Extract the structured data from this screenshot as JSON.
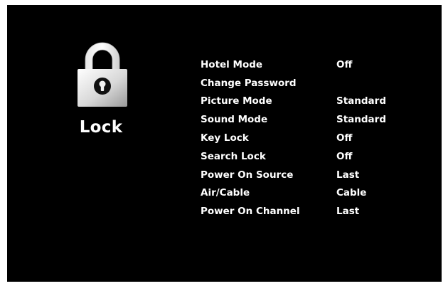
{
  "section": {
    "title": "Lock",
    "icon": "padlock-icon"
  },
  "menu": {
    "items": [
      {
        "label": "Hotel Mode",
        "value": "Off"
      },
      {
        "label": "Change Password",
        "value": ""
      },
      {
        "label": "Picture Mode",
        "value": "Standard"
      },
      {
        "label": "Sound Mode",
        "value": "Standard"
      },
      {
        "label": "Key Lock",
        "value": "Off"
      },
      {
        "label": "Search Lock",
        "value": "Off"
      },
      {
        "label": "Power On Source",
        "value": "Last"
      },
      {
        "label": "Air/Cable",
        "value": "Cable"
      },
      {
        "label": "Power On Channel",
        "value": "Last"
      }
    ]
  },
  "colors": {
    "background": "#000000",
    "text": "#ffffff"
  }
}
